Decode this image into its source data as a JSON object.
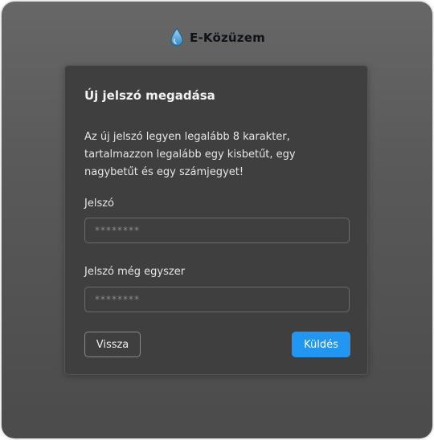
{
  "brand": {
    "name": "E-Közüzem",
    "icon": "water-drop-icon",
    "icon_color": "#2f86c9"
  },
  "form": {
    "title": "Új jelszó megadása",
    "description": "Az új jelszó legyen legalább 8 karakter, tartalmazzon legalább egy kisbetűt, egy nagybetűt és egy számjegyet!",
    "password_label": "Jelszó",
    "password_placeholder": "********",
    "password_value": "",
    "confirm_label": "Jelszó még egyszer",
    "confirm_placeholder": "********",
    "confirm_value": ""
  },
  "actions": {
    "back_label": "Vissza",
    "send_label": "Küldés"
  },
  "colors": {
    "accent": "#2196f3",
    "card_background": "#3f3f3f"
  }
}
